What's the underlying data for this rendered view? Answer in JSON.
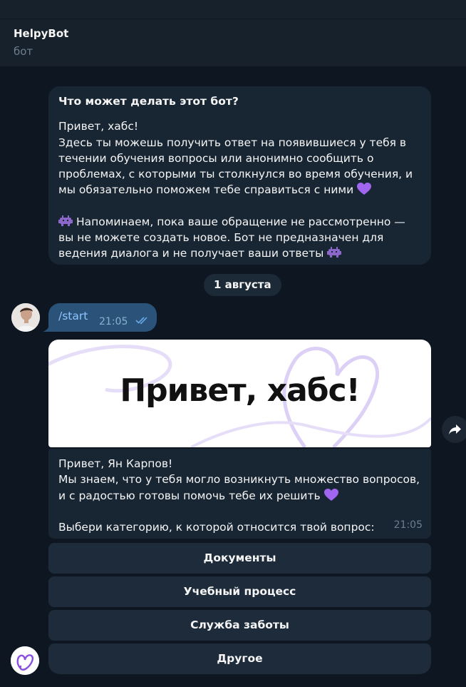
{
  "header": {
    "title": "HelpyBot",
    "subtitle": "бот"
  },
  "description": {
    "heading": "Что может делать этот бот?",
    "line1": "Привет, хабс!",
    "line2": "Здесь ты можешь получить ответ на появившиеся у тебя в течении обучения вопросы или анонимно сообщить о проблемах, с которыми ты столкнулся во время обучения, и мы обязательно поможем тебе справиться с ними",
    "line3": "Напоминаем, пока ваше обращение не рассмотренно — вы не можете создать новое. Бот не предназначен для ведения диалога и не получает ваши ответы"
  },
  "date_separator": "1 августа",
  "outgoing": {
    "text": "/start",
    "time": "21:05"
  },
  "banner": {
    "text": "Привет, хабс!"
  },
  "reply": {
    "line1": "Привет, Ян Карпов!",
    "line2": "Мы знаем, что у тебя могло возникнуть множество вопросов, и с радостью готовы помочь тебе их решить",
    "line3": "Выбери категорию, к которой относится твой вопрос:",
    "time": "21:05"
  },
  "keyboard": [
    "Документы",
    "Учебный процесс",
    "Служба заботы",
    "Другое"
  ],
  "colors": {
    "background": "#0e1621",
    "bubble": "#182533",
    "outgoing": "#2b5278",
    "accent": "#8ec5ff",
    "heart": "#a066f0"
  }
}
